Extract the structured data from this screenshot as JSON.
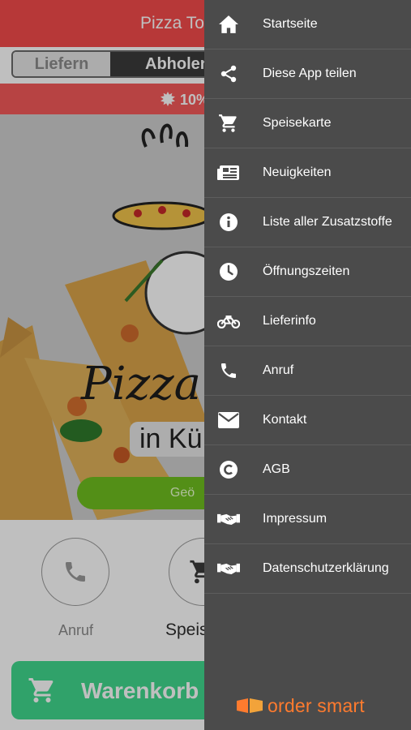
{
  "app": {
    "title": "Pizza Tor",
    "delivery_toggle": {
      "option_deliver": "Liefern",
      "option_pickup": "Abholen",
      "selected": "Abholen"
    },
    "promo": {
      "text": "10%"
    },
    "hero": {
      "brand": "Pizza",
      "sub": "in Kü",
      "open_status": "Geö"
    },
    "actions": [
      {
        "label": "Anruf",
        "icon": "phone-icon"
      },
      {
        "label": "Speis",
        "icon": "cart-icon"
      }
    ],
    "cart_button": {
      "label": "Warenkorb",
      "icon": "cart-icon"
    }
  },
  "drawer": {
    "items": [
      {
        "label": "Startseite",
        "icon": "home-icon"
      },
      {
        "label": "Diese App teilen",
        "icon": "share-icon"
      },
      {
        "label": "Speisekarte",
        "icon": "cart-icon"
      },
      {
        "label": "Neuigkeiten",
        "icon": "news-icon"
      },
      {
        "label": "Liste aller Zusatzstoffe",
        "icon": "info-icon"
      },
      {
        "label": "Öffnungszeiten",
        "icon": "clock-icon"
      },
      {
        "label": "Lieferinfo",
        "icon": "motorbike-icon"
      },
      {
        "label": "Anruf",
        "icon": "phone-icon"
      },
      {
        "label": "Kontakt",
        "icon": "envelope-icon"
      },
      {
        "label": "AGB",
        "icon": "copyright-icon"
      },
      {
        "label": "Impressum",
        "icon": "handshake-icon"
      },
      {
        "label": "Datenschutzerklärung",
        "icon": "handshake-icon"
      }
    ],
    "footer_logo": "order smart"
  },
  "colors": {
    "topbar": "#f54b4b",
    "drawer": "#4b4b4b",
    "cart_button": "#40d98e",
    "open_button": "#6fbf1f",
    "logo_orange": "#ff7b2e"
  }
}
